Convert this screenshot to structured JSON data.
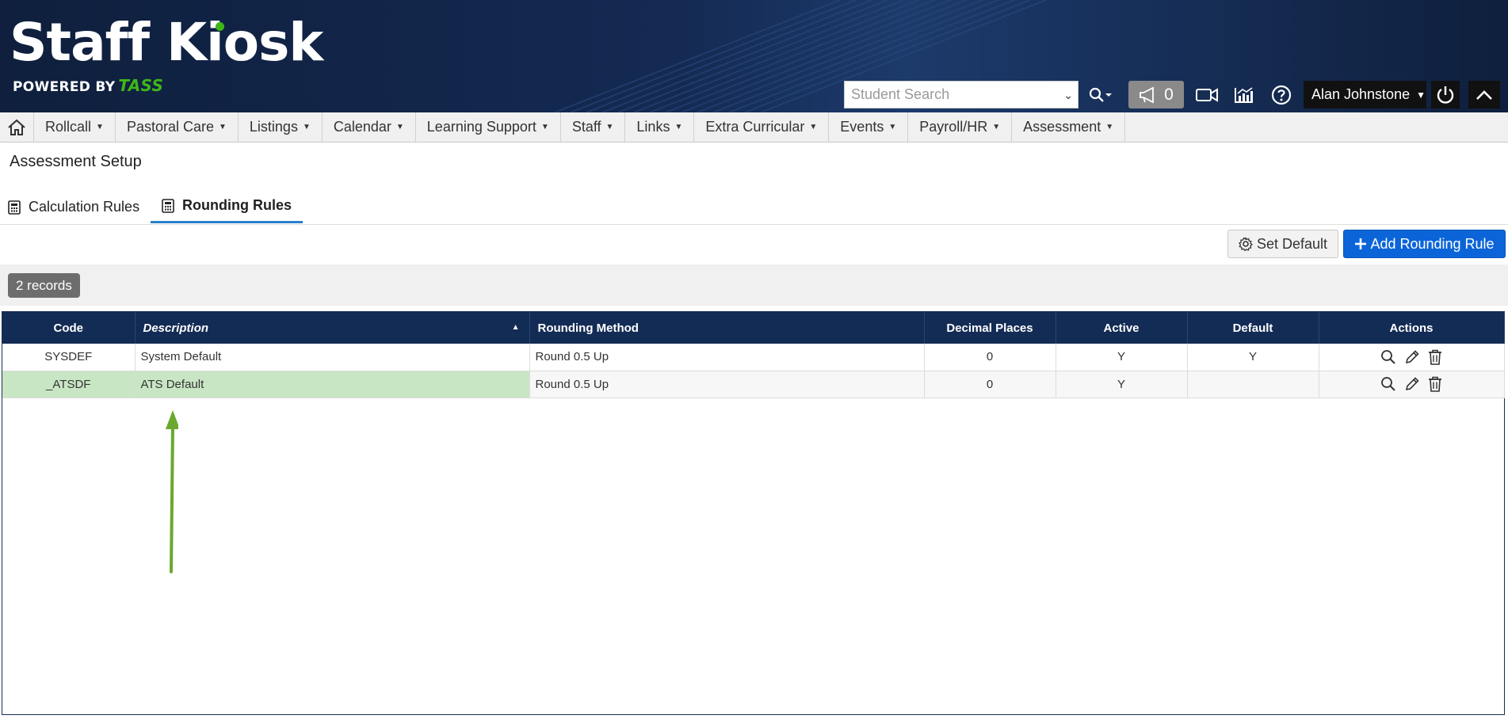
{
  "header": {
    "app_title": "Staff Kiosk",
    "powered_by": "POWERED BY",
    "brand": "TASS",
    "search_placeholder": "Student Search",
    "notice_count": "0",
    "user_name": "Alan Johnstone"
  },
  "nav": {
    "items": [
      {
        "label": "Rollcall"
      },
      {
        "label": "Pastoral Care"
      },
      {
        "label": "Listings"
      },
      {
        "label": "Calendar"
      },
      {
        "label": "Learning Support"
      },
      {
        "label": "Staff"
      },
      {
        "label": "Links"
      },
      {
        "label": "Extra Curricular"
      },
      {
        "label": "Events"
      },
      {
        "label": "Payroll/HR"
      },
      {
        "label": "Assessment"
      }
    ]
  },
  "page": {
    "title": "Assessment Setup",
    "tabs": [
      {
        "label": "Calculation Rules"
      },
      {
        "label": "Rounding Rules"
      }
    ],
    "set_default_label": "Set Default",
    "add_rule_label": "Add Rounding Rule",
    "records_label": "2 records"
  },
  "table": {
    "columns": [
      "Code",
      "Description",
      "Rounding Method",
      "Decimal Places",
      "Active",
      "Default",
      "Actions"
    ],
    "rows": [
      {
        "code": "SYSDEF",
        "description": "System Default",
        "method": "Round 0.5 Up",
        "decimals": "0",
        "active": "Y",
        "default": "Y"
      },
      {
        "code": "_ATSDF",
        "description": "ATS Default",
        "method": "Round 0.5 Up",
        "decimals": "0",
        "active": "Y",
        "default": ""
      }
    ]
  },
  "colors": {
    "header_bg": "#0f1f3d",
    "table_header_bg": "#132c55",
    "primary_button": "#0b65d8",
    "highlight_row": "#c8e6c4",
    "annotation_arrow": "#6aa82e",
    "brand_green": "#3fb618"
  },
  "icons": {
    "nav_home": "home-icon",
    "search_options": "search-icon",
    "notices": "megaphone-icon",
    "video": "video-icon",
    "stats": "chart-icon",
    "help": "help-icon",
    "power": "power-icon",
    "collapse": "chevron-up-icon",
    "tab": "calculator-icon",
    "set_default": "gear-icon",
    "add": "plus-icon",
    "view": "magnifier-icon",
    "edit": "pencil-icon",
    "delete": "trash-icon"
  }
}
